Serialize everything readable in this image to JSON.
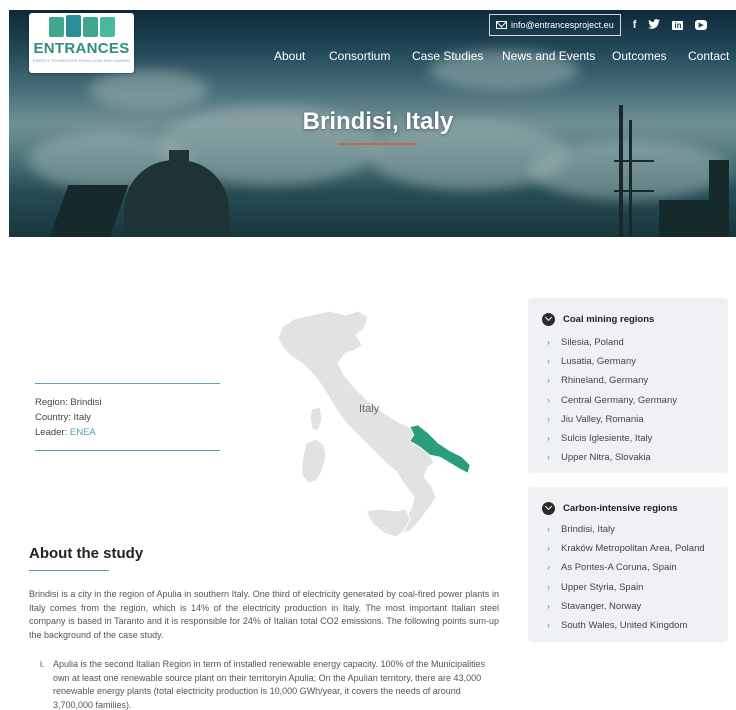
{
  "header": {
    "logo_text": "ENTRANCES",
    "logo_tagline": "ENERGY TRANSITIONS FROM COAL AND CARBON",
    "email": "info@entrancesproject.eu",
    "socials": [
      "facebook-icon",
      "twitter-icon",
      "linkedin-icon",
      "youtube-icon"
    ],
    "nav": [
      "About",
      "Consortium",
      "Case Studies",
      "News and Events",
      "Outcomes",
      "Contact"
    ]
  },
  "hero": {
    "title": "Brindisi, Italy"
  },
  "info": {
    "region": "Region: Brindisi",
    "country": "Country: Italy",
    "leader_label": "Leader: ",
    "leader_link": "ENEA"
  },
  "map": {
    "label": "Italy",
    "highlight_color": "#2a9d7c",
    "base_color": "#e2e2e2"
  },
  "about": {
    "title": "About the study",
    "paragraph": "Brindisi is a city in the region of Apulia in southern Italy. One third of electricity generated by coal-fired power plants in Italy comes from the region, which is 14% of the electricity production in Italy. The most important Italian steel company is based in Taranto and it is responsible for 24% of Italian total CO2 emissions. The following points sum-up the background of the case study.",
    "list": [
      {
        "num": "i.",
        "text": "Apulia is the second Italian Region in term of installed renewable energy capacity. 100% of the Municipalities own at least one renewable source plant on their territoryin Apulia; On the Apulian territory, there are 43,000 renewable energy plants (total electricity production is 10,000 GWh/year, it covers the needs of around 3,700,000 families)."
      }
    ]
  },
  "sidebar": {
    "coal": {
      "title": "Coal mining regions",
      "items": [
        "Silesia, Poland",
        "Lusatia, Germany",
        "Rhineland, Germany",
        "Central Germany, Germany",
        "Jiu Valley, Romania",
        "Sulcis Iglesiente, Italy",
        "Upper Nitra, Slovakia"
      ]
    },
    "carbon": {
      "title": "Carbon-intensive regions",
      "items": [
        "Brindisi, Italy",
        "Kraków Metropolitan Area, Poland",
        "As Pontes-A Coruna, Spain",
        "Upper Styria, Spain",
        "Stavanger, Norway",
        "South Wales, United Kingdom"
      ]
    }
  },
  "colors": {
    "accent": "#5aa3b3",
    "brand_green": "#2f8e7e",
    "hero_underline": "#c6693c"
  }
}
